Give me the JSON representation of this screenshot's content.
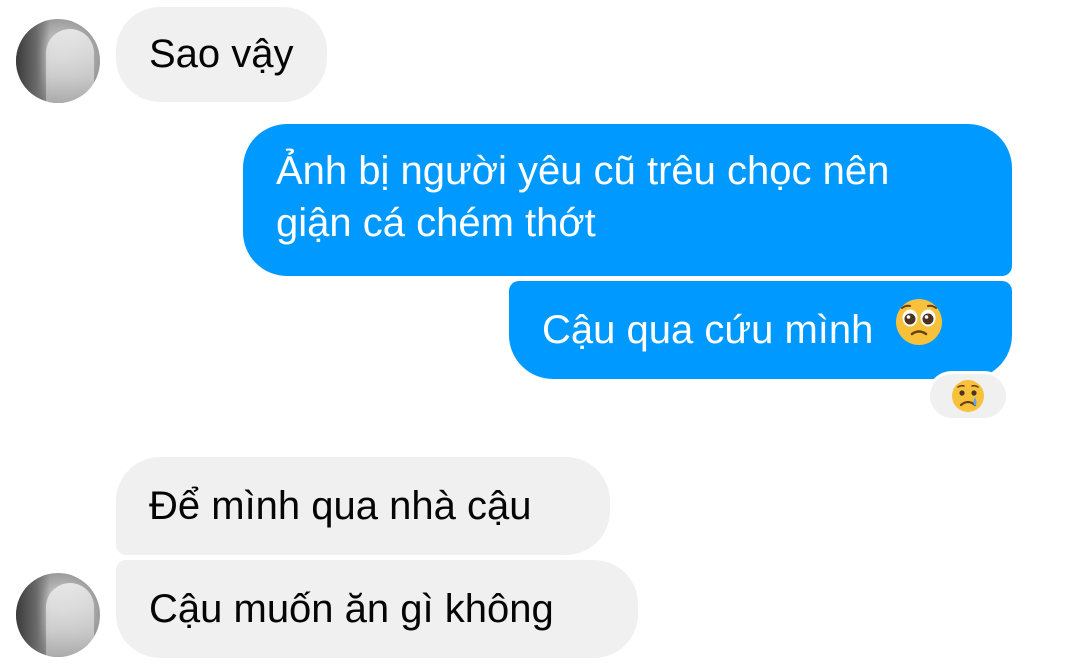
{
  "conversation": {
    "messages": [
      {
        "sender": "contact",
        "text": "Sao vậy"
      },
      {
        "sender": "me",
        "line1": "Ảnh bị người yêu cũ trêu chọc nên",
        "line2": "giận cá chém thớt"
      },
      {
        "sender": "me",
        "text": "Cậu qua cứu mình",
        "emoji": "pleading-face-icon"
      },
      {
        "sender": "contact",
        "text": "Để mình qua nhà cậu"
      },
      {
        "sender": "contact",
        "text": "Cậu muốn ăn gì không"
      }
    ],
    "reaction": {
      "emoji": "crying-face-icon"
    }
  },
  "colors": {
    "outgoing_bubble": "#0099ff",
    "incoming_bubble": "#f0f0f0",
    "outgoing_text": "#ffffff",
    "incoming_text": "#050505",
    "background": "#ffffff"
  }
}
